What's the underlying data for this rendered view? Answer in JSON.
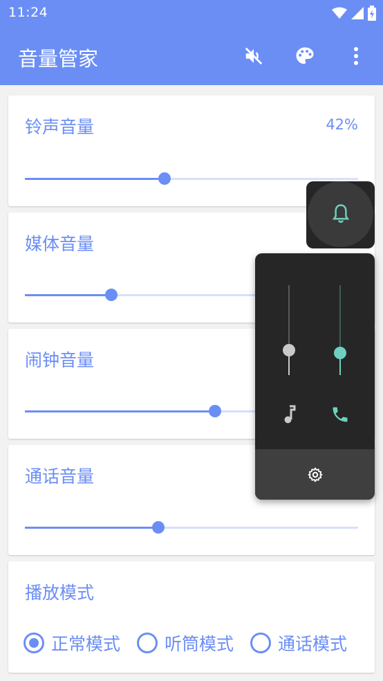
{
  "status_bar": {
    "time": "11:24"
  },
  "app_bar": {
    "title": "音量管家",
    "actions": [
      "mute-icon",
      "palette-icon",
      "more-vert-icon"
    ]
  },
  "volumes": [
    {
      "label": "铃声音量",
      "percent_text": "42%",
      "level": 0.42
    },
    {
      "label": "媒体音量",
      "percent_text": "",
      "level": 0.26
    },
    {
      "label": "闹钟音量",
      "percent_text": "",
      "level": 0.57
    },
    {
      "label": "通话音量",
      "percent_text": "",
      "level": 0.4
    }
  ],
  "play_mode": {
    "label": "播放模式",
    "options": [
      "正常模式",
      "听筒模式",
      "通话模式"
    ],
    "selected_index": 0
  },
  "overlay": {
    "bell_icon": "bell-icon",
    "media_level": 0.28,
    "call_level": 0.25,
    "media_icon": "music-note-icon",
    "call_icon": "phone-icon",
    "settings_icon": "gear-icon",
    "colors": {
      "media": "#c9c9c9",
      "call": "#6fd0c0"
    }
  },
  "colors": {
    "accent": "#6b8ef5",
    "track": "#d7e0fb"
  }
}
